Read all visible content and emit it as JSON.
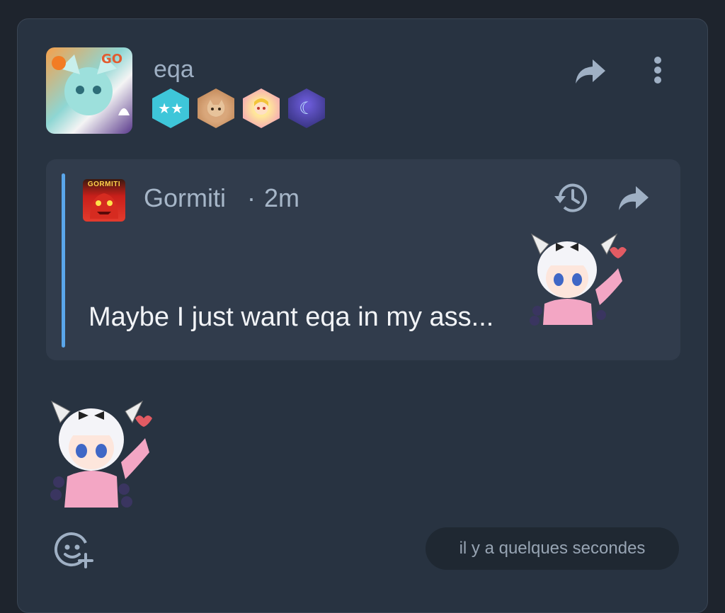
{
  "post": {
    "username": "eqa",
    "badges": [
      {
        "name": "stars-badge",
        "color": "#3ec6d9",
        "glyph": "★★"
      },
      {
        "name": "cat-badge",
        "color": "#d9a77b",
        "glyph": ""
      },
      {
        "name": "anime-badge",
        "color": "#f0a6c7",
        "glyph": ""
      },
      {
        "name": "moon-badge",
        "color": "#4a3a9a",
        "glyph": "☾"
      }
    ]
  },
  "quote": {
    "author": "Gormiti",
    "separator": "·",
    "time": "2m",
    "avatar_text": "GORMITI",
    "text": "Maybe I just want eqa in my ass..."
  },
  "footer": {
    "timestamp": "il y a quelques secondes"
  },
  "colors": {
    "accent_bar": "#5aa6ea",
    "card_bg": "#283341",
    "quote_bg": "#313c4c"
  }
}
